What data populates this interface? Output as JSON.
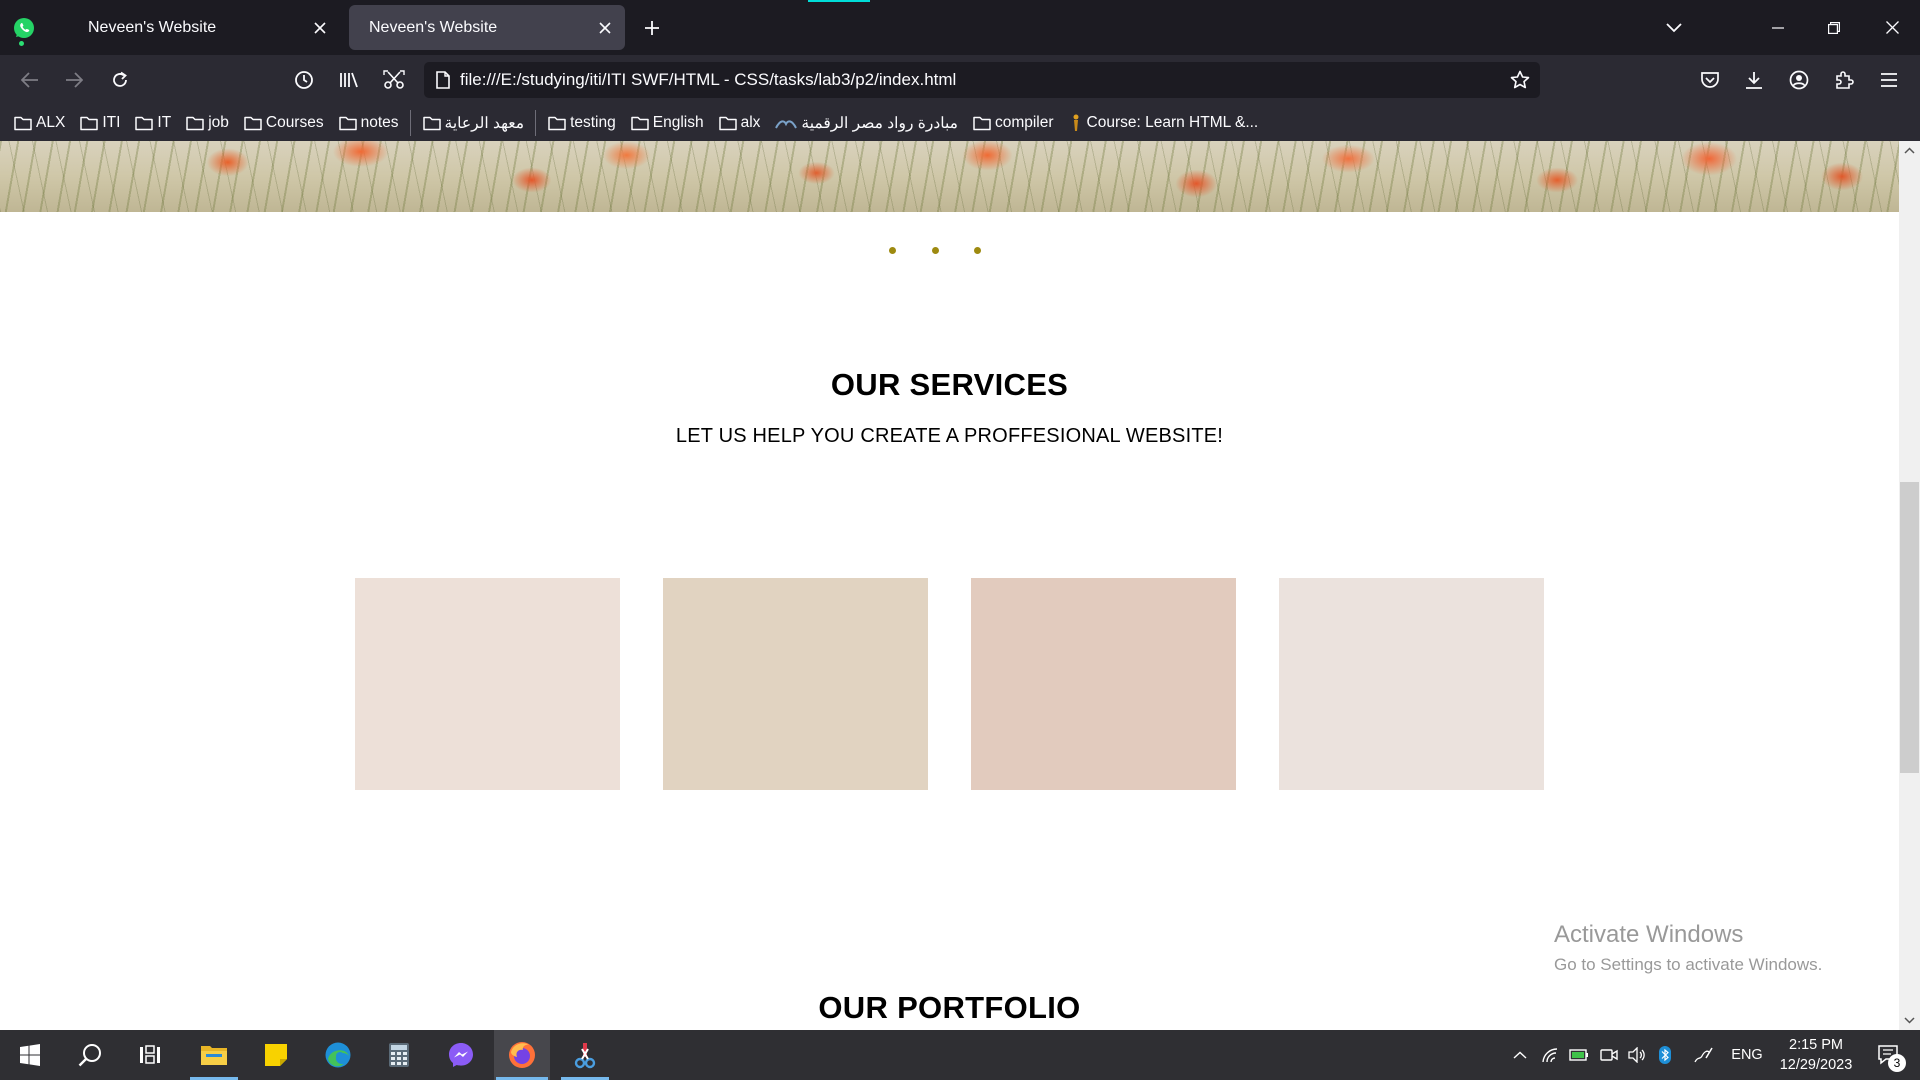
{
  "browser": {
    "tabs": [
      {
        "title": "Neveen's Website",
        "active": false
      },
      {
        "title": "Neveen's Website",
        "active": true
      }
    ],
    "url": "file:///E:/studying/iti/ITI SWF/HTML - CSS/tasks/lab3/p2/index.html",
    "bookmarks": [
      {
        "label": "ALX",
        "icon": "folder-icon"
      },
      {
        "label": "ITI",
        "icon": "folder-icon"
      },
      {
        "label": "IT",
        "icon": "folder-icon"
      },
      {
        "label": "job",
        "icon": "folder-icon"
      },
      {
        "label": "Courses",
        "icon": "folder-icon"
      },
      {
        "label": "notes",
        "icon": "folder-icon"
      },
      {
        "label": "معهد الرعاية",
        "icon": "folder-icon"
      },
      {
        "label": "testing",
        "icon": "folder-icon"
      },
      {
        "label": "English",
        "icon": "folder-icon"
      },
      {
        "label": "alx",
        "icon": "folder-icon"
      },
      {
        "label": "مبادرة رواد مصر الرقمية",
        "icon": "site-icon"
      },
      {
        "label": "compiler",
        "icon": "folder-icon"
      },
      {
        "label": "Course: Learn HTML &...",
        "icon": "site-icon"
      }
    ]
  },
  "page": {
    "services_heading": "OUR SERVICES",
    "services_subheading": "LET US HELP YOU CREATE A PROFFESIONAL WEBSITE!",
    "portfolio_heading": "OUR PORTFOLIO",
    "carousel_dots": 3,
    "service_card_colors": [
      "#ede0d8",
      "#e1d3c1",
      "#e2cbbe",
      "#ebe2dd"
    ],
    "dot_color": "#9e8a10"
  },
  "watermark": {
    "line1": "Activate Windows",
    "line2": "Go to Settings to activate Windows."
  },
  "taskbar": {
    "apps": [
      "start-icon",
      "search-icon",
      "task-view-icon",
      "file-explorer-icon",
      "sticky-notes-icon",
      "edge-icon",
      "calculator-icon",
      "messenger-icon",
      "firefox-icon",
      "snipping-tool-icon"
    ],
    "language": "ENG",
    "time": "2:15 PM",
    "date": "12/29/2023",
    "notification_count": "3"
  }
}
